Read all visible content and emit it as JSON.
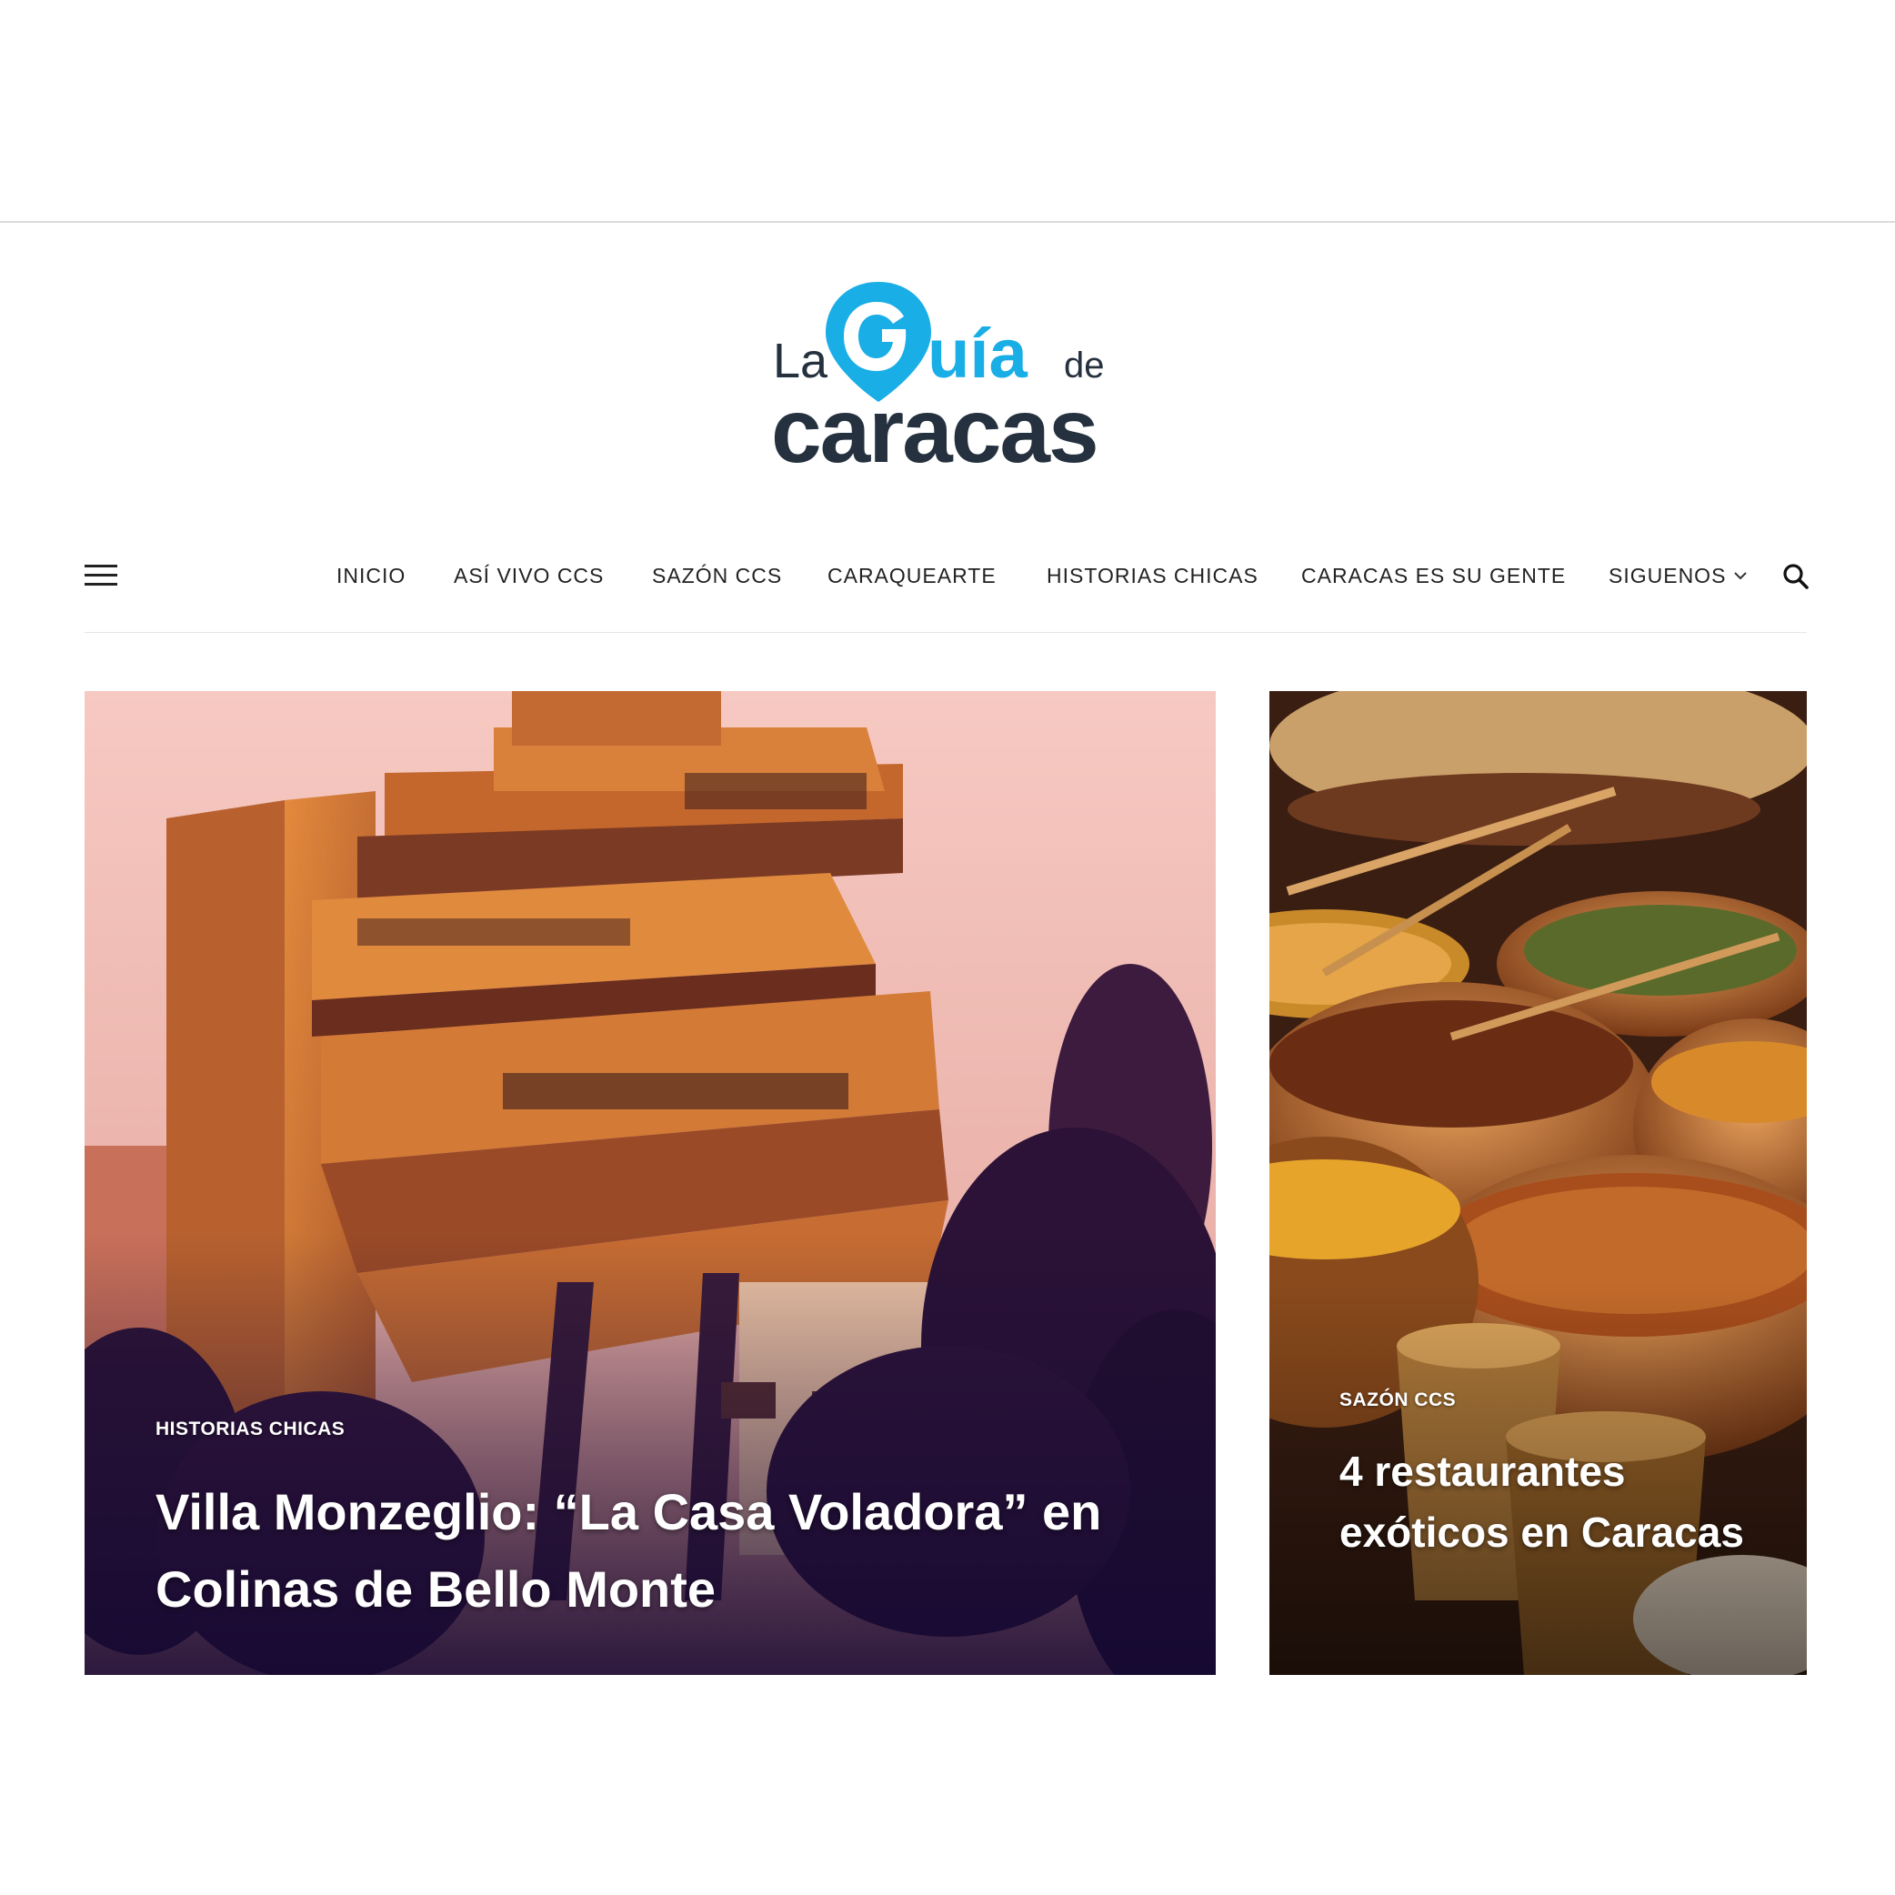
{
  "brand": {
    "logo_word_la": "La",
    "logo_word_guia": "Guía",
    "logo_word_de": "de",
    "logo_word_caracas": "caracas",
    "accent_color": "#1aaee6",
    "dark_color": "#25313f"
  },
  "nav": {
    "menu_icon": "hamburger-menu-icon",
    "items": [
      {
        "label": "INICIO"
      },
      {
        "label": "ASÍ VIVO CCS"
      },
      {
        "label": "SAZÓN CCS"
      },
      {
        "label": "CARAQUEARTE"
      },
      {
        "label": "HISTORIAS CHICAS"
      },
      {
        "label": "CARACAS ES SU GENTE"
      },
      {
        "label": "SIGUENOS"
      }
    ],
    "dropdown_icon": "chevron-down-icon",
    "search_icon": "search-icon"
  },
  "featured": [
    {
      "category": "HISTORIAS CHICAS",
      "title": "Villa Monzeglio: “La Casa Voladora” en Colinas de Bello Monte"
    },
    {
      "category": "SAZÓN CCS",
      "title": "4 restaurantes exóticos en Caracas"
    }
  ]
}
